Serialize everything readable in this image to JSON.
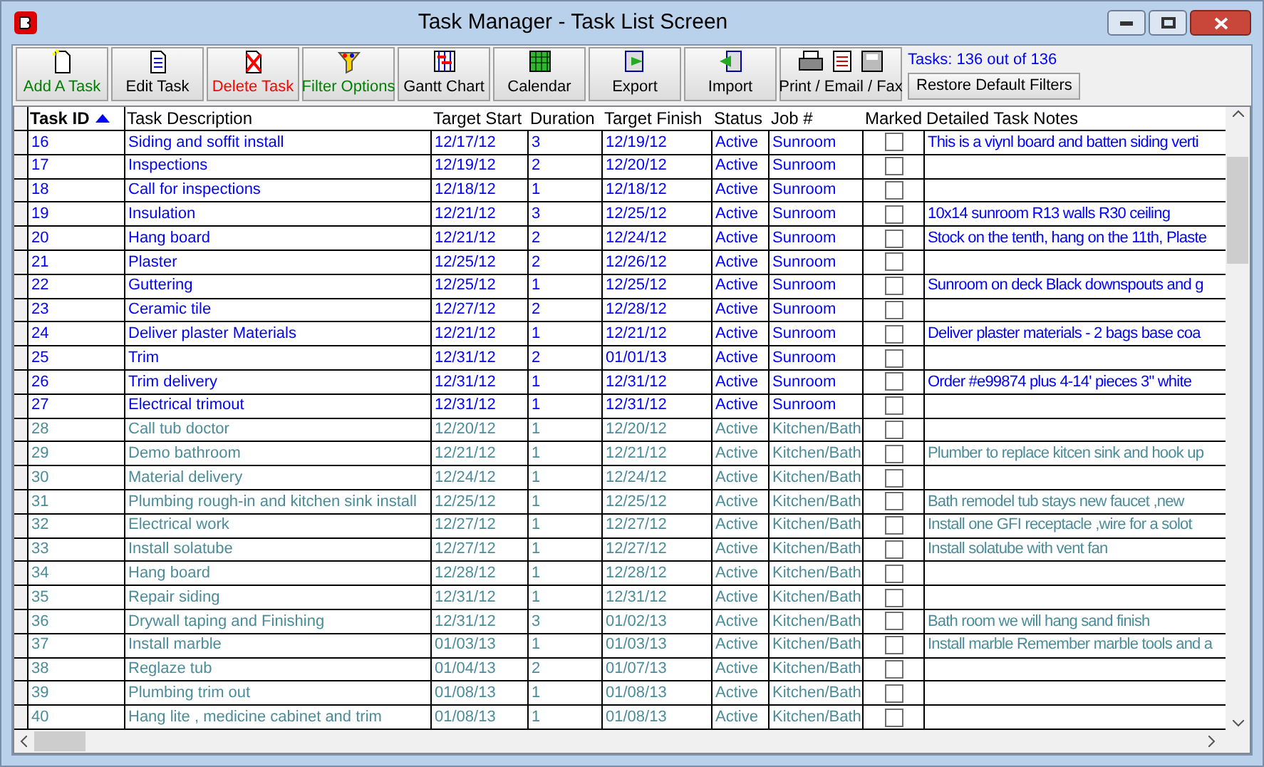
{
  "window": {
    "title": "Task Manager - Task List Screen"
  },
  "toolbar": [
    {
      "label": "Add A Task",
      "color": "#008000",
      "kind": "add"
    },
    {
      "label": "Edit Task",
      "color": "#000000",
      "kind": "edit"
    },
    {
      "label": "Delete Task",
      "color": "#ff0000",
      "kind": "delete"
    },
    {
      "label": "Filter Options",
      "color": "#008000",
      "kind": "filter"
    },
    {
      "label": "Gantt Chart",
      "color": "#000000",
      "kind": "gantt"
    },
    {
      "label": "Calendar",
      "color": "#000000",
      "kind": "calendar"
    },
    {
      "label": "Export",
      "color": "#000000",
      "kind": "export"
    },
    {
      "label": "Import",
      "color": "#000000",
      "kind": "import"
    },
    {
      "label": "Print / Email / Fax",
      "color": "#000000",
      "kind": "print"
    }
  ],
  "task_count": "Tasks: 136 out of 136",
  "restore_button": "Restore Default Filters",
  "table": {
    "columns": [
      "Task ID",
      "Task Description",
      "Target Start",
      "Duration",
      "Target Finish",
      "Status",
      "Job #",
      "Marked",
      "Detailed Task Notes"
    ],
    "rows": [
      {
        "id": "16",
        "desc": "Siding and soffit install",
        "start": "12/17/12",
        "duration": "3",
        "finish": "12/19/12",
        "status": "Active",
        "job": "Sunroom",
        "marked": false,
        "notes": "This is a viynl board and batten siding verti",
        "color": "#0000ff"
      },
      {
        "id": "17",
        "desc": "Inspections",
        "start": "12/19/12",
        "duration": "2",
        "finish": "12/20/12",
        "status": "Active",
        "job": "Sunroom",
        "marked": false,
        "color": "#0000ff"
      },
      {
        "id": "18",
        "desc": "Call for inspections",
        "start": "12/18/12",
        "duration": "1",
        "finish": "12/18/12",
        "status": "Active",
        "job": "Sunroom",
        "marked": false,
        "color": "#0000ff"
      },
      {
        "id": "19",
        "desc": "Insulation",
        "start": "12/21/12",
        "duration": "3",
        "finish": "12/25/12",
        "status": "Active",
        "job": "Sunroom",
        "marked": false,
        "notes": "10x14 sunroom  R13 walls R30 ceiling",
        "color": "#0000ff"
      },
      {
        "id": "20",
        "desc": "Hang board",
        "start": "12/21/12",
        "duration": "2",
        "finish": "12/24/12",
        "status": "Active",
        "job": "Sunroom",
        "marked": false,
        "notes": "Stock on the tenth, hang on the 11th, Plaste",
        "color": "#0000ff"
      },
      {
        "id": "21",
        "desc": "Plaster",
        "start": "12/25/12",
        "duration": "2",
        "finish": "12/26/12",
        "status": "Active",
        "job": "Sunroom",
        "marked": false,
        "color": "#0000ff"
      },
      {
        "id": "22",
        "desc": "Guttering",
        "start": "12/25/12",
        "duration": "1",
        "finish": "12/25/12",
        "status": "Active",
        "job": "Sunroom",
        "marked": false,
        "notes": "Sunroom on deck Black downspouts and g",
        "color": "#0000ff"
      },
      {
        "id": "23",
        "desc": "Ceramic tile",
        "start": "12/27/12",
        "duration": "2",
        "finish": "12/28/12",
        "status": "Active",
        "job": "Sunroom",
        "marked": false,
        "color": "#0000ff"
      },
      {
        "id": "24",
        "desc": "Deliver plaster Materials",
        "start": "12/21/12",
        "duration": "1",
        "finish": "12/21/12",
        "status": "Active",
        "job": "Sunroom",
        "marked": false,
        "notes": "Deliver plaster materials - 2 bags base coa",
        "color": "#0000ff"
      },
      {
        "id": "25",
        "desc": "Trim",
        "start": "12/31/12",
        "duration": "2",
        "finish": "01/01/13",
        "status": "Active",
        "job": "Sunroom",
        "marked": false,
        "color": "#0000ff"
      },
      {
        "id": "26",
        "desc": "Trim delivery",
        "start": "12/31/12",
        "duration": "1",
        "finish": "12/31/12",
        "status": "Active",
        "job": "Sunroom",
        "marked": false,
        "notes": "Order #e99874 plus 4-14' pieces 3\" white",
        "color": "#0000ff"
      },
      {
        "id": "27",
        "desc": "Electrical trimout",
        "start": "12/31/12",
        "duration": "1",
        "finish": "12/31/12",
        "status": "Active",
        "job": "Sunroom",
        "marked": false,
        "color": "#0000ff"
      },
      {
        "id": "28",
        "desc": "Call tub doctor",
        "start": "12/20/12",
        "duration": "1",
        "finish": "12/20/12",
        "status": "Active",
        "job": "Kitchen/Bath",
        "marked": false,
        "color": "#4a8c99"
      },
      {
        "id": "29",
        "desc": "Demo bathroom",
        "start": "12/21/12",
        "duration": "1",
        "finish": "12/21/12",
        "status": "Active",
        "job": "Kitchen/Bath",
        "marked": false,
        "notes": "Plumber to replace kitcen sink and hook up",
        "color": "#4a8c99"
      },
      {
        "id": "30",
        "desc": "Material delivery",
        "start": "12/24/12",
        "duration": "1",
        "finish": "12/24/12",
        "status": "Active",
        "job": "Kitchen/Bath",
        "marked": false,
        "color": "#4a8c99"
      },
      {
        "id": "31",
        "desc": "Plumbing rough-in and kitchen sink install",
        "start": "12/25/12",
        "duration": "1",
        "finish": "12/25/12",
        "status": "Active",
        "job": "Kitchen/Bath",
        "marked": false,
        "notes": "Bath remodel  tub stays new faucet ,new",
        "color": "#4a8c99"
      },
      {
        "id": "32",
        "desc": "Electrical work",
        "start": "12/27/12",
        "duration": "1",
        "finish": "12/27/12",
        "status": "Active",
        "job": "Kitchen/Bath",
        "marked": false,
        "notes": "Install one GFI receptacle ,wire for a solot",
        "color": "#4a8c99"
      },
      {
        "id": "33",
        "desc": "Install solatube",
        "start": "12/27/12",
        "duration": "1",
        "finish": "12/27/12",
        "status": "Active",
        "job": "Kitchen/Bath",
        "marked": false,
        "notes": "Install solatube with vent fan",
        "color": "#4a8c99"
      },
      {
        "id": "34",
        "desc": "Hang board",
        "start": "12/28/12",
        "duration": "1",
        "finish": "12/28/12",
        "status": "Active",
        "job": "Kitchen/Bath",
        "marked": false,
        "color": "#4a8c99"
      },
      {
        "id": "35",
        "desc": "Repair siding",
        "start": "12/31/12",
        "duration": "1",
        "finish": "12/31/12",
        "status": "Active",
        "job": "Kitchen/Bath",
        "marked": false,
        "color": "#4a8c99"
      },
      {
        "id": "36",
        "desc": "Drywall taping and Finishing",
        "start": "12/31/12",
        "duration": "3",
        "finish": "01/02/13",
        "status": "Active",
        "job": "Kitchen/Bath",
        "marked": false,
        "notes": "Bath room we will hang sand finish",
        "color": "#4a8c99"
      },
      {
        "id": "37",
        "desc": "Install marble",
        "start": "01/03/13",
        "duration": "1",
        "finish": "01/03/13",
        "status": "Active",
        "job": "Kitchen/Bath",
        "marked": false,
        "notes": "Install marble Remember marble tools and a",
        "color": "#4a8c99"
      },
      {
        "id": "38",
        "desc": "Reglaze tub",
        "start": "01/04/13",
        "duration": "2",
        "finish": "01/07/13",
        "status": "Active",
        "job": "Kitchen/Bath",
        "marked": false,
        "color": "#4a8c99"
      },
      {
        "id": "39",
        "desc": "Plumbing trim out",
        "start": "01/08/13",
        "duration": "1",
        "finish": "01/08/13",
        "status": "Active",
        "job": "Kitchen/Bath",
        "marked": false,
        "color": "#4a8c99"
      },
      {
        "id": "40",
        "desc": "Hang lite , medicine cabinet and trim",
        "start": "01/08/13",
        "duration": "1",
        "finish": "01/08/13",
        "status": "Active",
        "job": "Kitchen/Bath",
        "marked": false,
        "color": "#4a8c99"
      }
    ]
  }
}
